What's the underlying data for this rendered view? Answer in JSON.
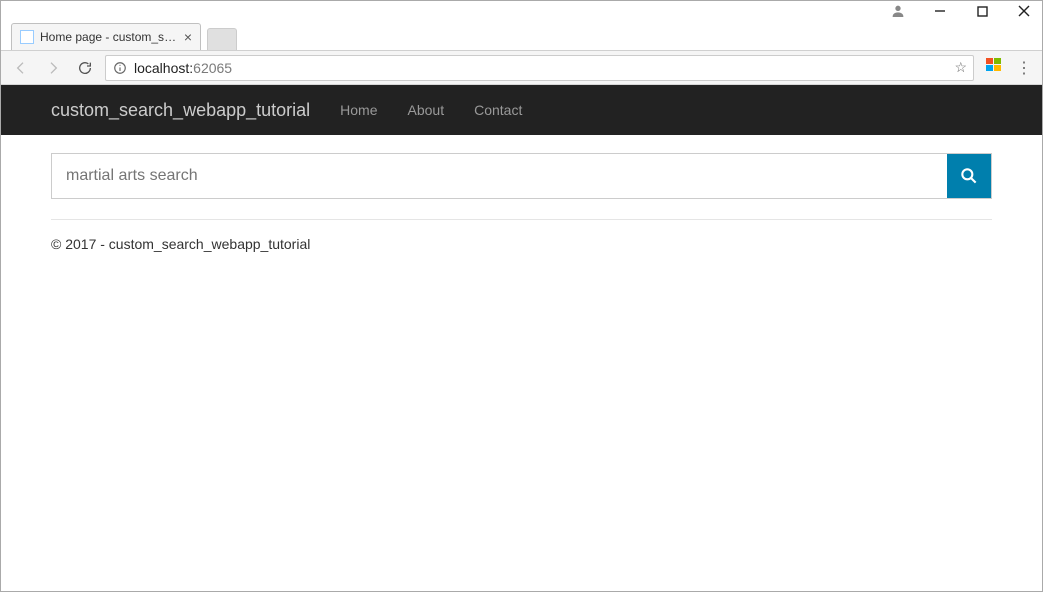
{
  "window": {
    "tab_title": "Home page - custom_se…",
    "url_host": "localhost:",
    "url_port": "62065"
  },
  "navbar": {
    "brand": "custom_search_webapp_tutorial",
    "links": [
      "Home",
      "About",
      "Contact"
    ]
  },
  "search": {
    "placeholder": "martial arts search"
  },
  "footer": {
    "text": "© 2017 - custom_search_webapp_tutorial"
  }
}
